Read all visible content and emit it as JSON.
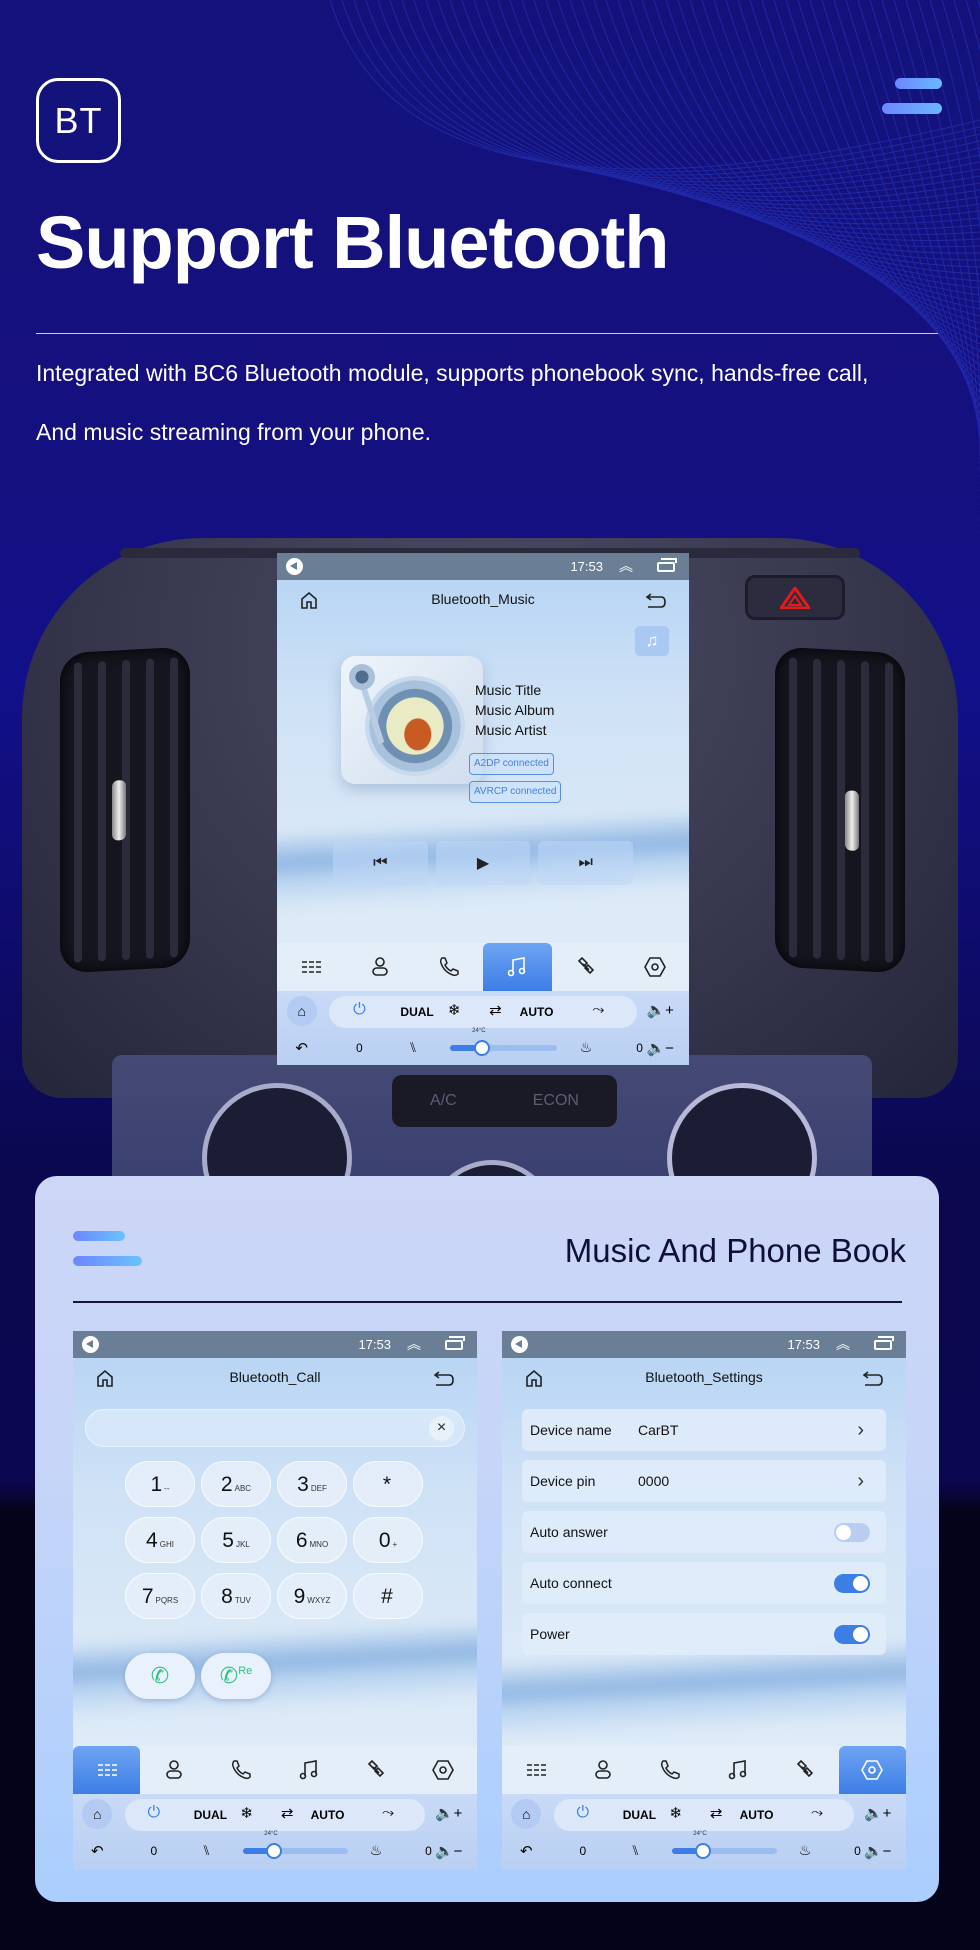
{
  "header": {
    "badge": "BT",
    "title": "Support Bluetooth",
    "description_line1": "Integrated with BC6 Bluetooth module, supports phonebook sync, hands-free call,",
    "description_line2": "And music streaming from your phone."
  },
  "colors": {
    "accent_blue": "#3c7ee6",
    "hazard_red": "#e21b1b",
    "background_navy": "#14127a",
    "card_bg": "#c6d5f8",
    "call_green": "#2fbf7f"
  },
  "dashboard": {
    "buttons": [
      "A/C",
      "ECON"
    ]
  },
  "status_bar": {
    "time": "17:53"
  },
  "music_screen": {
    "title": "Bluetooth_Music",
    "track": {
      "title": "Music Title",
      "album": "Music Album",
      "artist": "Music Artist"
    },
    "connections": [
      "A2DP  connected",
      "AVRCP connected"
    ],
    "controls": [
      "previous",
      "play",
      "next"
    ],
    "active_tab": "music"
  },
  "tabs": [
    {
      "name": "apps",
      "icon": "grid-lines-icon"
    },
    {
      "name": "contacts",
      "icon": "person-icon"
    },
    {
      "name": "call",
      "icon": "phone-icon"
    },
    {
      "name": "music",
      "icon": "music-note-icon"
    },
    {
      "name": "link",
      "icon": "link-icon"
    },
    {
      "name": "settings",
      "icon": "hex-settings-icon"
    }
  ],
  "climate": {
    "dual_label": "DUAL",
    "auto_label": "AUTO",
    "temperature": "24°C",
    "left_seat_level": "0",
    "right_seat_level": "0",
    "fan_speed_fraction": 0.3
  },
  "section": {
    "title": "Music And Phone Book"
  },
  "call_screen": {
    "title": "Bluetooth_Call",
    "input_value": "",
    "clear_label": "×",
    "active_tab": "apps",
    "keys": [
      {
        "digit": "1",
        "sub": "--"
      },
      {
        "digit": "2",
        "sub": "ABC"
      },
      {
        "digit": "3",
        "sub": "DEF"
      },
      {
        "digit": "*",
        "sub": ""
      },
      {
        "digit": "4",
        "sub": "GHI"
      },
      {
        "digit": "5",
        "sub": "JKL"
      },
      {
        "digit": "6",
        "sub": "MNO"
      },
      {
        "digit": "0",
        "sub": "+"
      },
      {
        "digit": "7",
        "sub": "PQRS"
      },
      {
        "digit": "8",
        "sub": "TUV"
      },
      {
        "digit": "9",
        "sub": "WXYZ"
      },
      {
        "digit": "#",
        "sub": ""
      }
    ],
    "redial_label": "Re"
  },
  "settings_screen": {
    "title": "Bluetooth_Settings",
    "active_tab": "settings",
    "rows": [
      {
        "label": "Device name",
        "value": "CarBT",
        "type": "link"
      },
      {
        "label": "Device pin",
        "value": "0000",
        "type": "link"
      },
      {
        "label": "Auto answer",
        "value": false,
        "type": "toggle"
      },
      {
        "label": "Auto connect",
        "value": true,
        "type": "toggle"
      },
      {
        "label": "Power",
        "value": true,
        "type": "toggle"
      }
    ]
  }
}
